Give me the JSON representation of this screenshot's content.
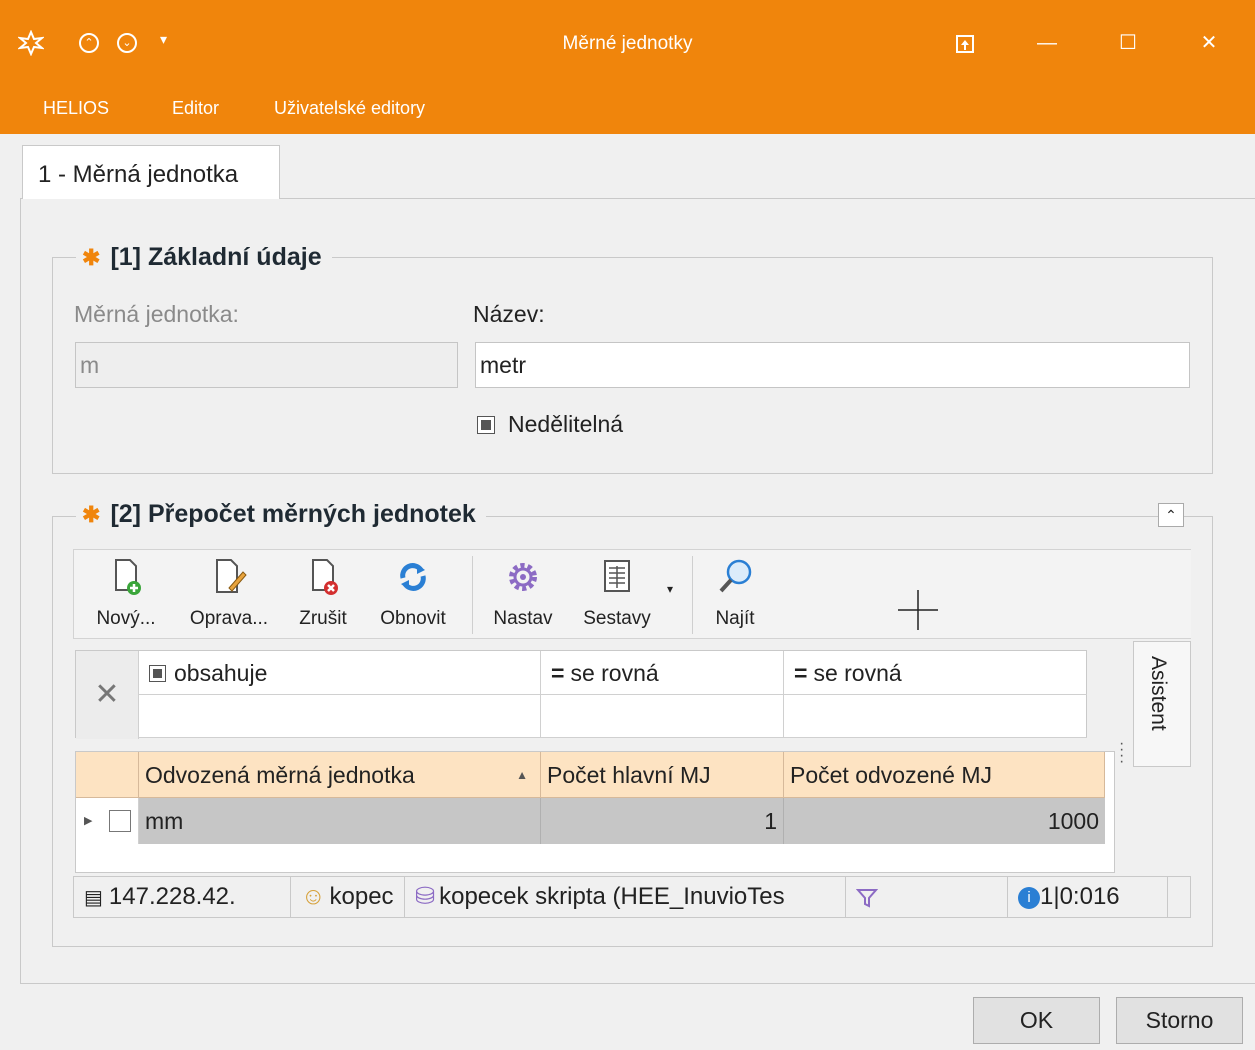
{
  "window": {
    "title": "Měrné jednotky",
    "accent_color": "#f0850c",
    "quick_access": [
      "chevron-up-circle-icon",
      "chevron-down-circle-icon",
      "dropdown-arrow-icon"
    ]
  },
  "menu": [
    "HELIOS",
    "Editor",
    "Uživatelské editory"
  ],
  "tab": {
    "label": "1 - Měrná jednotka"
  },
  "group1": {
    "title": "[1] Základní údaje",
    "unit_label": "Měrná jednotka:",
    "unit_value": "m",
    "name_label": "Název:",
    "name_value": "metr",
    "indivisible_label": "Nedělitelná"
  },
  "group2": {
    "title": "[2] Přepočet měrných jednotek",
    "toolbar": [
      "Nový...",
      "Oprava...",
      "Zrušit",
      "Obnovit",
      "Nastav",
      "Sestavy",
      "Najít"
    ],
    "filters": [
      "obsahuje",
      "se rovná",
      "se rovná"
    ],
    "columns": [
      "Odvozená měrná jednotka",
      "Počet hlavní MJ",
      "Počet odvozené MJ"
    ],
    "rows": [
      {
        "unit": "mm",
        "main_count": "1",
        "derived_count": "1000"
      }
    ],
    "assistant": "Asistent"
  },
  "status": {
    "server": "147.228.42.",
    "user": "kopec",
    "database": "kopecek skripta (HEE_InuvioTes",
    "info": "1|0:016"
  },
  "buttons": {
    "ok": "OK",
    "cancel": "Storno"
  }
}
